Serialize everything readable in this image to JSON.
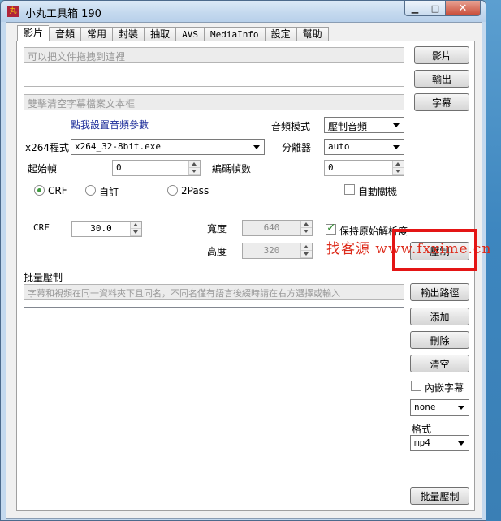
{
  "window": {
    "title": "小丸工具箱 190",
    "app_icon_glyph": "丸",
    "minimize_glyph": "▁",
    "maximize_glyph": "□",
    "close_glyph": "✕"
  },
  "tabs": [
    {
      "label": "影片",
      "active": true
    },
    {
      "label": "音頻",
      "active": false
    },
    {
      "label": "常用",
      "active": false
    },
    {
      "label": "封裝",
      "active": false
    },
    {
      "label": "抽取",
      "active": false
    },
    {
      "label": "AVS",
      "active": false
    },
    {
      "label": "MediaInfo",
      "active": false
    },
    {
      "label": "設定",
      "active": false
    },
    {
      "label": "幫助",
      "active": false
    }
  ],
  "video": {
    "video_input_placeholder": "可以把文件拖拽到這裡",
    "video_button": "影片",
    "output_value": "",
    "output_button": "輸出",
    "subtitle_placeholder": "雙擊清空字幕檔案文本框",
    "subtitle_button": "字幕",
    "audio_settings_link": "點我設置音頻參數",
    "audio_mode_label": "音頻模式",
    "audio_mode_value": "壓制音頻",
    "x264_label": "x264程式",
    "x264_value": "x264_32-8bit.exe",
    "demuxer_label": "分離器",
    "demuxer_value": "auto",
    "start_frame_label": "起始幀",
    "start_frame_value": "0",
    "encode_frames_label": "編碼幀數",
    "encode_frames_value": "0",
    "mode_crf": "CRF",
    "mode_custom": "自訂",
    "mode_2pass": "2Pass",
    "auto_shutdown_label": "自動關機",
    "crf_label": "CRF",
    "crf_value": "30.0",
    "width_label": "寬度",
    "width_value": "640",
    "height_label": "高度",
    "height_value": "320",
    "keep_resolution_label": "保持原始解析度",
    "encode_button": "壓制"
  },
  "batch": {
    "section_label": "批量壓制",
    "hint_placeholder": "字幕和視頻在同一資料夾下且同名，不同名僅有語言後綴時請在右方選擇或輸入",
    "output_path_button": "輸出路徑",
    "add_button": "添加",
    "delete_button": "刪除",
    "clear_button": "清空",
    "embed_subtitle_label": "內嵌字幕",
    "subtitle_lang_value": "none",
    "format_label": "格式",
    "format_value": "mp4",
    "batch_encode_button": "批量壓制"
  },
  "watermark": {
    "text": "找客源 www.fxxime.cn"
  },
  "state": {
    "keep_resolution_checked": true,
    "auto_shutdown_checked": false,
    "embed_subtitle_checked": false,
    "selected_mode": "CRF"
  },
  "colors": {
    "watermark_red": "#dd2a1a",
    "highlight_red": "#e41515",
    "link_blue": "#1b2b99",
    "radio_green": "#3f9a3f"
  }
}
